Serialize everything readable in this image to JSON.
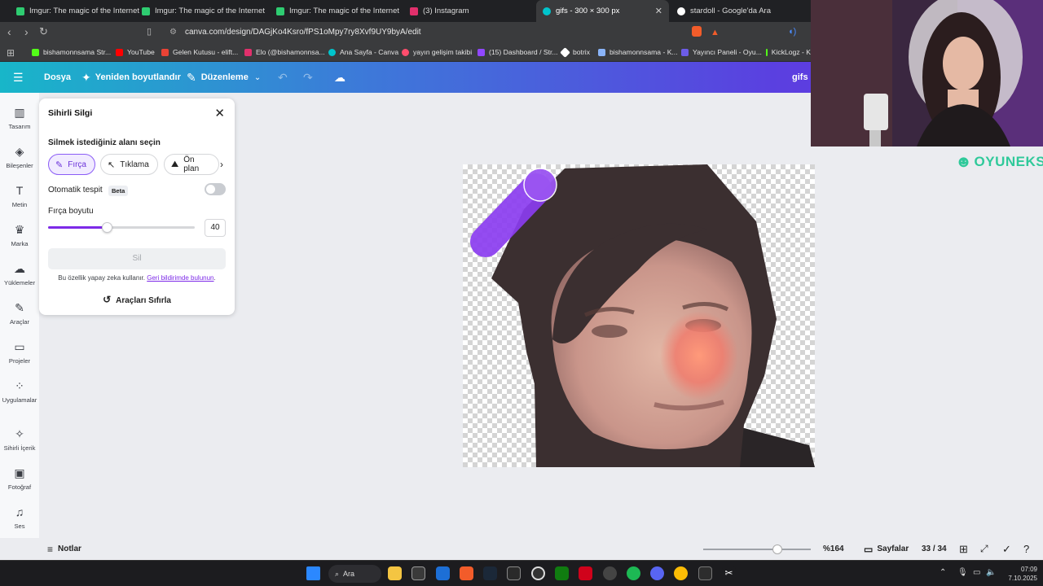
{
  "browser": {
    "tabs": [
      {
        "title": "Imgur: The magic of the Internet",
        "color": "#2ecc71"
      },
      {
        "title": "Imgur: The magic of the Internet",
        "color": "#2ecc71"
      },
      {
        "title": "Imgur: The magic of the Internet",
        "color": "#2ecc71"
      },
      {
        "title": "(3) Instagram",
        "color": "#e1306c"
      },
      {
        "title": "gifs - 300 × 300 px",
        "color": "#00c4cc"
      },
      {
        "title": "stardoll - Google'da Ara",
        "color": "#ffffff"
      }
    ],
    "url": "canva.com/design/DAGjKo4Ksro/fPS1oMpy7ry8Xvf9UY9byA/edit",
    "bookmarks": [
      "bishamonnsama Str...",
      "YouTube",
      "Gelen Kutusu - elift...",
      "Elo (@bishamonnsa...",
      "Ana Sayfa - Canva",
      "yayın gelişim takibi",
      "(15) Dashboard / Str...",
      "botrix",
      "bishamonnsama - K...",
      "Yayıncı Paneli - Oyu...",
      "KickLogz - K"
    ]
  },
  "header": {
    "file": "Dosya",
    "resize": "Yeniden boyutlandır",
    "edit": "Düzenleme",
    "design_title": "gifs"
  },
  "leftnav": [
    {
      "label": "Tasarım",
      "icon": "layout-icon"
    },
    {
      "label": "Bileşenler",
      "icon": "elements-icon"
    },
    {
      "label": "Metin",
      "icon": "text-icon"
    },
    {
      "label": "Marka",
      "icon": "brand-icon"
    },
    {
      "label": "Yüklemeler",
      "icon": "upload-icon"
    },
    {
      "label": "Araçlar",
      "icon": "tools-icon"
    },
    {
      "label": "Projeler",
      "icon": "folder-icon"
    },
    {
      "label": "Uygulamalar",
      "icon": "apps-icon"
    },
    {
      "label": "Sihirli İçerik",
      "icon": "magic-media-icon"
    },
    {
      "label": "Fotoğraf",
      "icon": "photo-icon"
    },
    {
      "label": "Ses",
      "icon": "music-icon"
    }
  ],
  "panel": {
    "title": "Sihirli Silgi",
    "subtitle": "Silmek istediğiniz alanı seçin",
    "modes": [
      "Fırça",
      "Tıklama",
      "Ön plan"
    ],
    "auto_detect": "Otomatik tespit",
    "beta": "Beta",
    "brush_size_label": "Fırça boyutu",
    "brush_size": "40",
    "brush_size_fraction": 0.4,
    "erase": "Sil",
    "note_text": "Bu özellik yapay zeka kullanır.",
    "note_link": "Geri bildirimde bulunun",
    "note_end": ".",
    "reset": "Araçları Sıfırla"
  },
  "bottom": {
    "notes": "Notlar",
    "zoom": "%164",
    "pages": "Sayfalar",
    "page_count": "33 / 34"
  },
  "taskbar": {
    "search": "Ara",
    "time": "07:09",
    "date": "7.10.2025"
  },
  "stream": {
    "brand": "OYUNEKS"
  },
  "colors": {
    "accent": "#7d2ae8",
    "brush": "#8b3df0"
  }
}
